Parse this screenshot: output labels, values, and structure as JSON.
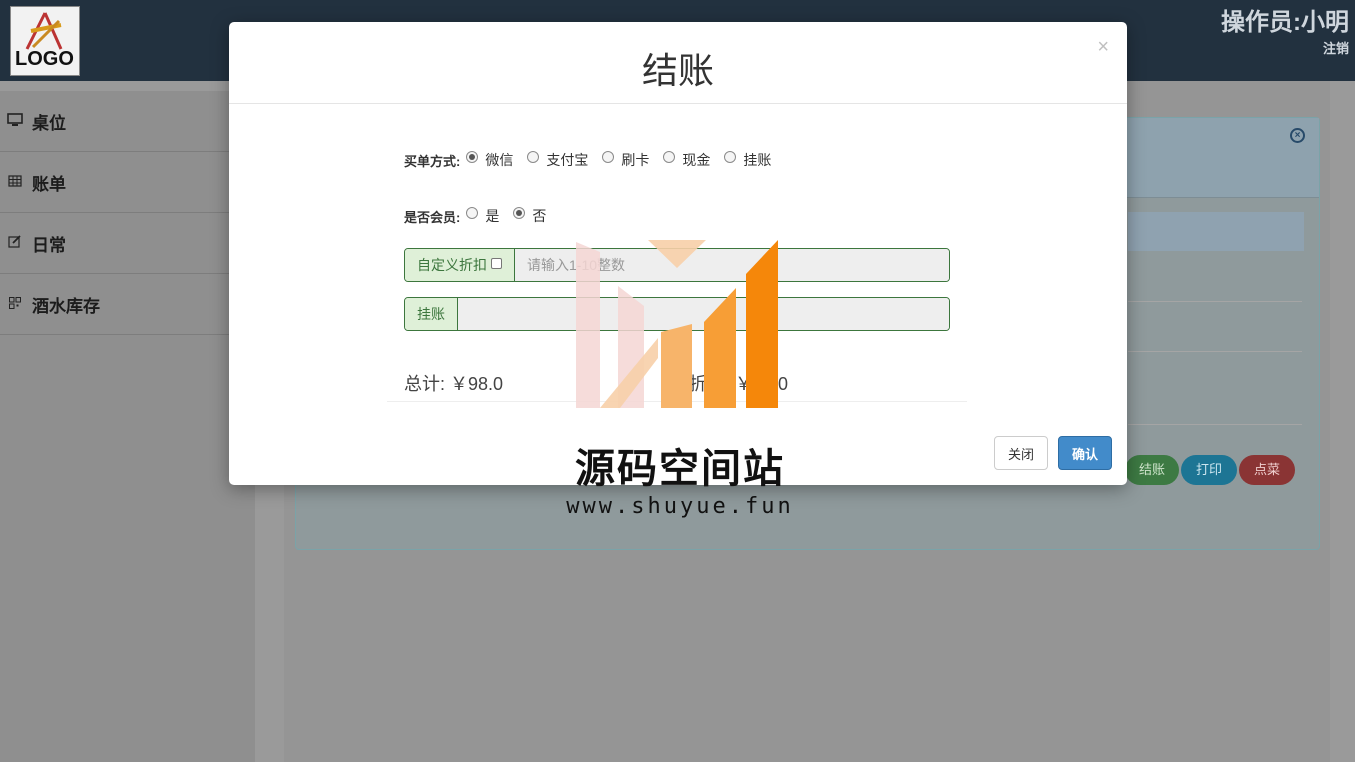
{
  "header": {
    "logo_text": "LOGO",
    "operator": "操作员:小明",
    "logout": "注销"
  },
  "sidebar": {
    "items": [
      {
        "label": "桌位",
        "icon": "monitor-icon"
      },
      {
        "label": "账单",
        "icon": "table-icon"
      },
      {
        "label": "日常",
        "icon": "edit-icon"
      },
      {
        "label": "酒水库存",
        "icon": "qrcode-icon"
      }
    ]
  },
  "background_buttons": {
    "checkout": "结账",
    "print": "打印",
    "order": "点菜"
  },
  "modal": {
    "title": "结账",
    "close_x": "×",
    "payment_label": "买单方式:",
    "payment_options": [
      {
        "label": "微信",
        "checked": true
      },
      {
        "label": "支付宝",
        "checked": false
      },
      {
        "label": "刷卡",
        "checked": false
      },
      {
        "label": "现金",
        "checked": false
      },
      {
        "label": "挂账",
        "checked": false
      }
    ],
    "member_label": "是否会员:",
    "member_options": [
      {
        "label": "是",
        "checked": false
      },
      {
        "label": "否",
        "checked": true
      }
    ],
    "discount_addon": "自定义折扣",
    "discount_placeholder": "请输入1-10整数",
    "credit_addon": "挂账",
    "credit_value": "",
    "total_text": "总计: ￥98.0",
    "discount_total_text": "折后: ￥98.0",
    "close_button": "关闭",
    "confirm_button": "确认"
  },
  "watermark": {
    "title": "源码空间站",
    "url": "www.shuyue.fun"
  },
  "colors": {
    "topbar": "#22313f",
    "primary": "#428bca",
    "success_border": "#3c763d",
    "success_bg": "#dff0d8",
    "wm_orange": "#f5870a"
  }
}
